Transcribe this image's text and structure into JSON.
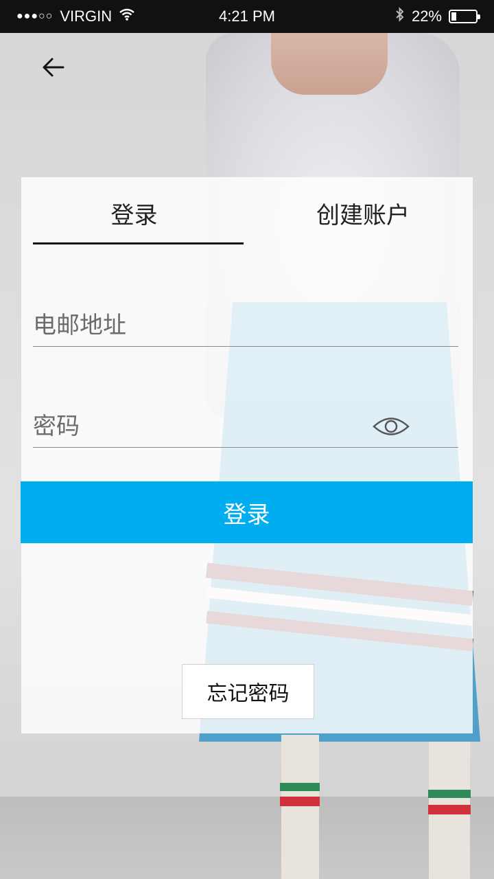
{
  "status_bar": {
    "carrier": "VIRGIN",
    "signal_dots": "●●●○○",
    "time": "4:21 PM",
    "battery_percent_label": "22%",
    "battery_level": 0.22
  },
  "nav": {
    "back_icon": "arrow-left-icon"
  },
  "tabs": [
    {
      "label": "登录",
      "active": true
    },
    {
      "label": "创建账户",
      "active": false
    }
  ],
  "form": {
    "email_placeholder": "电邮地址",
    "password_placeholder": "密码",
    "show_password_icon": "eye-icon",
    "submit_label": "登录",
    "forgot_label": "忘记密码"
  },
  "colors": {
    "accent": "#00aef0",
    "status_bar_bg": "#111111",
    "tab_indicator": "#111111"
  }
}
